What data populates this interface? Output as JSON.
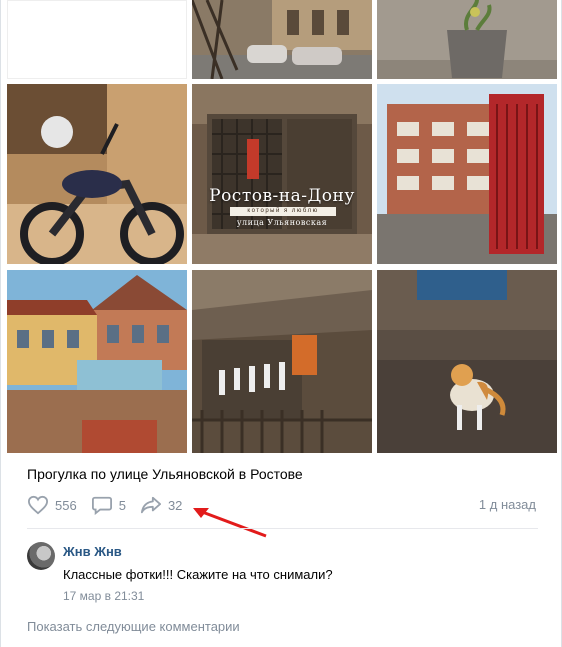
{
  "post": {
    "photo_overlay": {
      "title": "Ростов-на-Дону",
      "band": "который я люблю",
      "subtitle": "улица Ульяновская"
    },
    "text": "Прогулка по улице Ульяновской в Ростове",
    "likes": "556",
    "comments": "5",
    "shares": "32",
    "time": "1 д назад"
  },
  "comment": {
    "author": "Жнв Жнв",
    "text": "Классные фотки!!! Скажите на что снимали?",
    "date": "17 мар в 21:31"
  },
  "show_more": "Показать следующие комментарии",
  "icons": {
    "like": "heart-icon",
    "comment": "comment-icon",
    "share": "share-icon"
  },
  "colors": {
    "link": "#2a5885",
    "muted": "#818c99",
    "annotation_arrow": "#e21b1b"
  }
}
